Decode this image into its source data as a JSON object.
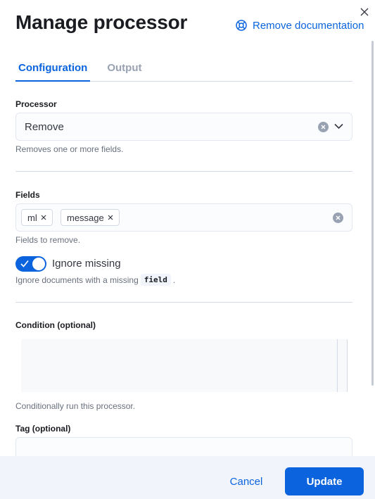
{
  "header": {
    "title": "Manage processor",
    "doc_link_label": "Remove documentation",
    "doc_link_icon": "help-lifebuoy-icon",
    "close_icon": "close-icon"
  },
  "tabs": [
    {
      "label": "Configuration",
      "active": true
    },
    {
      "label": "Output",
      "active": false
    }
  ],
  "processor": {
    "label": "Processor",
    "value": "Remove",
    "help": "Removes one or more fields."
  },
  "fields": {
    "label": "Fields",
    "chips": [
      "ml",
      "message"
    ],
    "help": "Fields to remove."
  },
  "ignore_missing": {
    "label": "Ignore missing",
    "enabled": true,
    "help_before": "Ignore documents with a missing",
    "help_code": "field",
    "help_after": "."
  },
  "condition": {
    "label": "Condition (optional)",
    "help": "Conditionally run this processor."
  },
  "tag": {
    "label": "Tag (optional)",
    "value": ""
  },
  "footer": {
    "cancel_label": "Cancel",
    "update_label": "Update"
  },
  "colors": {
    "accent": "#0b64dd",
    "footer_bg": "#f1f4fa",
    "border": "#d3dae6"
  }
}
